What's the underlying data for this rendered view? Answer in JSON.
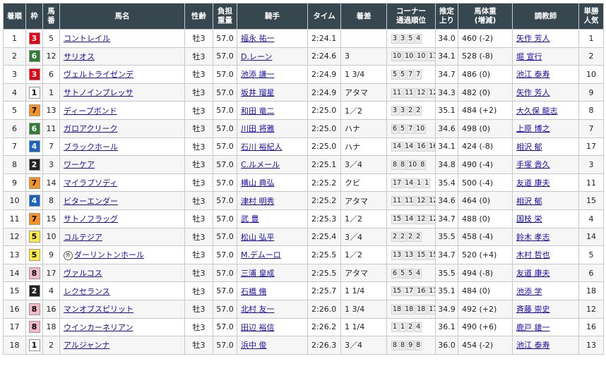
{
  "headers": {
    "rank": "着順",
    "waku": "枠",
    "umaban_line1": "馬",
    "umaban_line2": "番",
    "name": "馬名",
    "sexage": "性齢",
    "weight_line1": "負担",
    "weight_line2": "重量",
    "jockey": "騎手",
    "time": "タイム",
    "margin": "着差",
    "corner_line1": "コーナー",
    "corner_line2": "通過順位",
    "last3f_line1": "推定",
    "last3f_line2": "上り",
    "body_line1": "馬体重",
    "body_line2": "(増減)",
    "trainer": "調教師",
    "pop_line1": "単勝",
    "pop_line2": "人気"
  },
  "waku_colors": {
    "1": {
      "bg": "#ffffff",
      "fg": "#000000"
    },
    "2": {
      "bg": "#222222",
      "fg": "#ffffff"
    },
    "3": {
      "bg": "#e60012",
      "fg": "#ffffff"
    },
    "4": {
      "bg": "#1565c0",
      "fg": "#ffffff"
    },
    "5": {
      "bg": "#ffeb3b",
      "fg": "#000000"
    },
    "6": {
      "bg": "#2e7d32",
      "fg": "#ffffff"
    },
    "7": {
      "bg": "#f7931e",
      "fg": "#000000"
    },
    "8": {
      "bg": "#f5b8c8",
      "fg": "#000000"
    }
  },
  "foreign_mark": "外",
  "rows": [
    {
      "rank": "1",
      "waku": "3",
      "umaban": "5",
      "name": "コントレイル",
      "foreign": false,
      "sexage": "牡3",
      "weight": "57.0",
      "jockey": "福永 祐一",
      "time": "2:24.1",
      "margin": "",
      "corner": [
        "3",
        "3",
        "5",
        "4"
      ],
      "last3f": "34.0",
      "body": "460 (-2)",
      "trainer": "矢作 芳人",
      "pop": "1"
    },
    {
      "rank": "2",
      "waku": "6",
      "umaban": "12",
      "name": "サリオス",
      "foreign": false,
      "sexage": "牡3",
      "weight": "57.0",
      "jockey": "D.レーン",
      "time": "2:24.6",
      "margin": "3",
      "corner": [
        "10",
        "10",
        "10",
        "11"
      ],
      "last3f": "34.1",
      "body": "528 (-8)",
      "trainer": "堀 宣行",
      "pop": "2"
    },
    {
      "rank": "3",
      "waku": "3",
      "umaban": "6",
      "name": "ヴェルトライゼンデ",
      "foreign": false,
      "sexage": "牡3",
      "weight": "57.0",
      "jockey": "池添 謙一",
      "time": "2:24.9",
      "margin": "1 3/4",
      "corner": [
        "5",
        "5",
        "7",
        "7"
      ],
      "last3f": "34.7",
      "body": "486 (0)",
      "trainer": "池江 泰寿",
      "pop": "10"
    },
    {
      "rank": "4",
      "waku": "1",
      "umaban": "1",
      "name": "サトノインプレッサ",
      "foreign": false,
      "sexage": "牡3",
      "weight": "57.0",
      "jockey": "坂井 瑠星",
      "time": "2:24.9",
      "margin": "アタマ",
      "corner": [
        "11",
        "11",
        "12",
        "12"
      ],
      "last3f": "34.3",
      "body": "482 (0)",
      "trainer": "矢作 芳人",
      "pop": "9"
    },
    {
      "rank": "5",
      "waku": "7",
      "umaban": "13",
      "name": "ディープボンド",
      "foreign": false,
      "sexage": "牡3",
      "weight": "57.0",
      "jockey": "和田 竜二",
      "time": "2:25.0",
      "margin": "1／2",
      "corner": [
        "3",
        "3",
        "2",
        "2"
      ],
      "last3f": "35.1",
      "body": "484 (+2)",
      "trainer": "大久保 龍志",
      "pop": "8"
    },
    {
      "rank": "6",
      "waku": "6",
      "umaban": "11",
      "name": "ガロアクリーク",
      "foreign": false,
      "sexage": "牡3",
      "weight": "57.0",
      "jockey": "川田 将雅",
      "time": "2:25.0",
      "margin": "ハナ",
      "corner": [
        "6",
        "5",
        "7",
        "10"
      ],
      "last3f": "34.6",
      "body": "498 (0)",
      "trainer": "上原 博之",
      "pop": "7"
    },
    {
      "rank": "7",
      "waku": "4",
      "umaban": "7",
      "name": "ブラックホール",
      "foreign": false,
      "sexage": "牡3",
      "weight": "57.0",
      "jockey": "石川 裕紀人",
      "time": "2:25.0",
      "margin": "ハナ",
      "corner": [
        "14",
        "14",
        "16",
        "16"
      ],
      "last3f": "34.1",
      "body": "424 (-8)",
      "trainer": "相沢 郁",
      "pop": "17"
    },
    {
      "rank": "8",
      "waku": "2",
      "umaban": "3",
      "name": "ワーケア",
      "foreign": false,
      "sexage": "牡3",
      "weight": "57.0",
      "jockey": "C.ルメール",
      "time": "2:25.1",
      "margin": "3／4",
      "corner": [
        "8",
        "8",
        "10",
        "8"
      ],
      "last3f": "34.8",
      "body": "490 (-4)",
      "trainer": "手塚 貴久",
      "pop": "3"
    },
    {
      "rank": "9",
      "waku": "7",
      "umaban": "14",
      "name": "マイラプソディ",
      "foreign": false,
      "sexage": "牡3",
      "weight": "57.0",
      "jockey": "横山 典弘",
      "time": "2:25.2",
      "margin": "クビ",
      "corner": [
        "17",
        "14",
        "1",
        "1"
      ],
      "last3f": "35.4",
      "body": "500 (-4)",
      "trainer": "友道 康夫",
      "pop": "11"
    },
    {
      "rank": "10",
      "waku": "4",
      "umaban": "8",
      "name": "ビターエンダー",
      "foreign": false,
      "sexage": "牡3",
      "weight": "57.0",
      "jockey": "津村 明秀",
      "time": "2:25.2",
      "margin": "アタマ",
      "corner": [
        "11",
        "11",
        "12",
        "12"
      ],
      "last3f": "34.6",
      "body": "464 (0)",
      "trainer": "相沢 郁",
      "pop": "15"
    },
    {
      "rank": "11",
      "waku": "7",
      "umaban": "15",
      "name": "サトノフラッグ",
      "foreign": false,
      "sexage": "牡3",
      "weight": "57.0",
      "jockey": "武 豊",
      "time": "2:25.3",
      "margin": "1／2",
      "corner": [
        "15",
        "14",
        "12",
        "12"
      ],
      "last3f": "34.7",
      "body": "488 (0)",
      "trainer": "国枝 栄",
      "pop": "4"
    },
    {
      "rank": "12",
      "waku": "5",
      "umaban": "10",
      "name": "コルテジア",
      "foreign": false,
      "sexage": "牡3",
      "weight": "57.0",
      "jockey": "松山 弘平",
      "time": "2:25.4",
      "margin": "3／4",
      "corner": [
        "2",
        "2",
        "2",
        "2"
      ],
      "last3f": "35.5",
      "body": "458 (-4)",
      "trainer": "鈴木 孝志",
      "pop": "14"
    },
    {
      "rank": "13",
      "waku": "5",
      "umaban": "9",
      "name": "ダーリントンホール",
      "foreign": true,
      "sexage": "牡3",
      "weight": "57.0",
      "jockey": "M.デムーロ",
      "time": "2:25.5",
      "margin": "1／2",
      "corner": [
        "13",
        "13",
        "15",
        "15"
      ],
      "last3f": "34.7",
      "body": "520 (+4)",
      "trainer": "木村 哲也",
      "pop": "5"
    },
    {
      "rank": "14",
      "waku": "8",
      "umaban": "17",
      "name": "ヴァルコス",
      "foreign": false,
      "sexage": "牡3",
      "weight": "57.0",
      "jockey": "三浦 皇成",
      "time": "2:25.5",
      "margin": "アタマ",
      "corner": [
        "6",
        "5",
        "5",
        "4"
      ],
      "last3f": "35.5",
      "body": "494 (-8)",
      "trainer": "友道 康夫",
      "pop": "6"
    },
    {
      "rank": "15",
      "waku": "2",
      "umaban": "4",
      "name": "レクセランス",
      "foreign": false,
      "sexage": "牡3",
      "weight": "57.0",
      "jockey": "石橋 脩",
      "time": "2:25.7",
      "margin": "1 1/4",
      "corner": [
        "15",
        "17",
        "16",
        "17"
      ],
      "last3f": "35.1",
      "body": "484 (0)",
      "trainer": "池添 学",
      "pop": "18"
    },
    {
      "rank": "16",
      "waku": "8",
      "umaban": "16",
      "name": "マンオブスピリット",
      "foreign": false,
      "sexage": "牡3",
      "weight": "57.0",
      "jockey": "北村 友一",
      "time": "2:26.0",
      "margin": "1 3/4",
      "corner": [
        "18",
        "18",
        "18",
        "17"
      ],
      "last3f": "34.9",
      "body": "492 (+2)",
      "trainer": "斉藤 崇史",
      "pop": "12"
    },
    {
      "rank": "17",
      "waku": "8",
      "umaban": "18",
      "name": "ウインカーネリアン",
      "foreign": false,
      "sexage": "牡3",
      "weight": "57.0",
      "jockey": "田辺 裕信",
      "time": "2:26.2",
      "margin": "1 1/4",
      "corner": [
        "1",
        "1",
        "2",
        "4"
      ],
      "last3f": "36.1",
      "body": "490 (+6)",
      "trainer": "鹿戸 雄一",
      "pop": "16"
    },
    {
      "rank": "18",
      "waku": "1",
      "umaban": "2",
      "name": "アルジャンナ",
      "foreign": false,
      "sexage": "牡3",
      "weight": "57.0",
      "jockey": "浜中 俊",
      "time": "2:26.3",
      "margin": "3／4",
      "corner": [
        "8",
        "8",
        "9",
        "8"
      ],
      "last3f": "36.0",
      "body": "454 (-2)",
      "trainer": "池江 泰寿",
      "pop": "13"
    }
  ]
}
